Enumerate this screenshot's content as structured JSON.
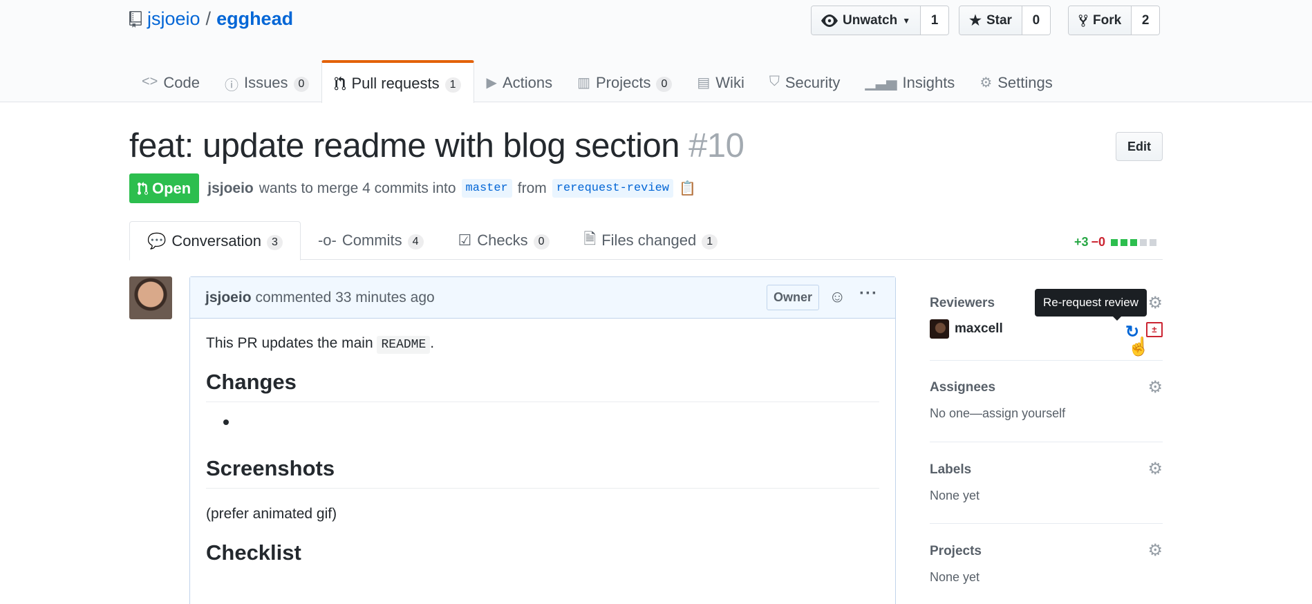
{
  "repo": {
    "owner": "jsjoeio",
    "separator": "/",
    "name": "egghead"
  },
  "actions": {
    "watch": {
      "label": "Unwatch",
      "count": "1"
    },
    "star": {
      "label": "Star",
      "count": "0"
    },
    "fork": {
      "label": "Fork",
      "count": "2"
    }
  },
  "nav": [
    {
      "label": "Code"
    },
    {
      "label": "Issues",
      "count": "0"
    },
    {
      "label": "Pull requests",
      "count": "1"
    },
    {
      "label": "Actions"
    },
    {
      "label": "Projects",
      "count": "0"
    },
    {
      "label": "Wiki"
    },
    {
      "label": "Security"
    },
    {
      "label": "Insights"
    },
    {
      "label": "Settings"
    }
  ],
  "pr": {
    "title": "feat: update readme with blog section",
    "number": "#10",
    "edit_label": "Edit",
    "state": "Open",
    "author": "jsjoeio",
    "merge_text": "wants to merge 4 commits into",
    "base_branch": "master",
    "from_text": "from",
    "head_branch": "rerequest-review"
  },
  "tabs": [
    {
      "label": "Conversation",
      "count": "3"
    },
    {
      "label": "Commits",
      "count": "4"
    },
    {
      "label": "Checks",
      "count": "0"
    },
    {
      "label": "Files changed",
      "count": "1"
    }
  ],
  "diffstat": {
    "additions": "+3",
    "deletions": "−0"
  },
  "comment": {
    "author": "jsjoeio",
    "action": "commented 33 minutes ago",
    "badge": "Owner",
    "intro_before": "This PR updates the main",
    "intro_code": "README",
    "intro_after": ".",
    "h_changes": "Changes",
    "h_screenshots": "Screenshots",
    "screenshots_text": "(prefer animated gif)",
    "h_checklist": "Checklist"
  },
  "sidebar": {
    "reviewers": {
      "heading": "Reviewers",
      "reviewer": "maxcell",
      "tooltip": "Re-request review"
    },
    "assignees": {
      "heading": "Assignees",
      "text": "No one—assign yourself"
    },
    "labels": {
      "heading": "Labels",
      "text": "None yet"
    },
    "projects": {
      "heading": "Projects",
      "text": "None yet"
    }
  },
  "colors": {
    "link": "#0366d6",
    "open": "#2cbe4e",
    "tab_accent": "#e36209",
    "add": "#28a745",
    "del": "#cb2431"
  }
}
